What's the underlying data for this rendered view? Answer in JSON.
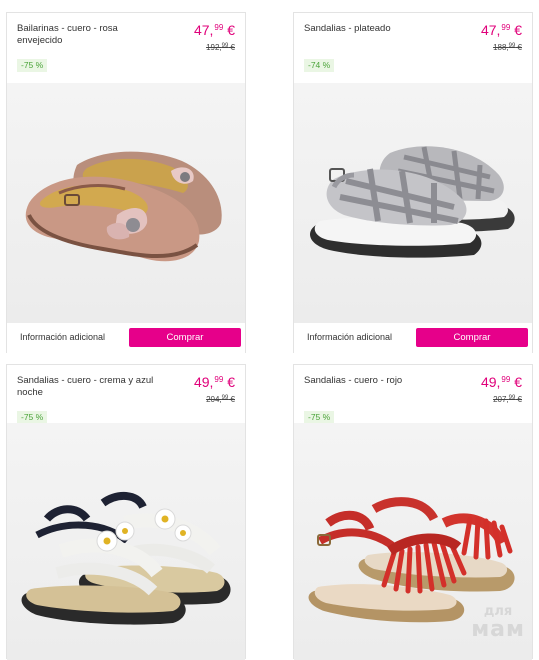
{
  "products": [
    {
      "name": "Bailarinas - cuero - rosa envejecido",
      "price_main": "47,",
      "price_cents": "99",
      "price_currency": " €",
      "old_main": "192,",
      "old_cents": "99",
      "old_currency": " €",
      "discount": "-75 %",
      "info_label": "Información adicional",
      "buy_label": "Comprar",
      "image_icon": "ballet-flat-shoe-icon"
    },
    {
      "name": "Sandalias - plateado",
      "price_main": "47,",
      "price_cents": "99",
      "price_currency": " €",
      "old_main": "188,",
      "old_cents": "99",
      "old_currency": " €",
      "discount": "-74 %",
      "info_label": "Información adicional",
      "buy_label": "Comprar",
      "image_icon": "glitter-sandal-icon"
    },
    {
      "name": "Sandalias - cuero - crema y azul noche",
      "price_main": "49,",
      "price_cents": "99",
      "price_currency": " €",
      "old_main": "204,",
      "old_cents": "99",
      "old_currency": " €",
      "discount": "-75 %",
      "image_icon": "flower-sandal-icon"
    },
    {
      "name": "Sandalias - cuero - rojo",
      "price_main": "49,",
      "price_cents": "99",
      "price_currency": " €",
      "old_main": "207,",
      "old_cents": "99",
      "old_currency": " €",
      "discount": "-75 %",
      "image_icon": "fringe-sandal-icon"
    }
  ],
  "watermark": {
    "line1": "для",
    "line2": "мам"
  },
  "colors": {
    "accent": "#e6008a",
    "price": "#e0007a",
    "discount_text": "#4aa339",
    "discount_bg": "#eaf6e4"
  }
}
